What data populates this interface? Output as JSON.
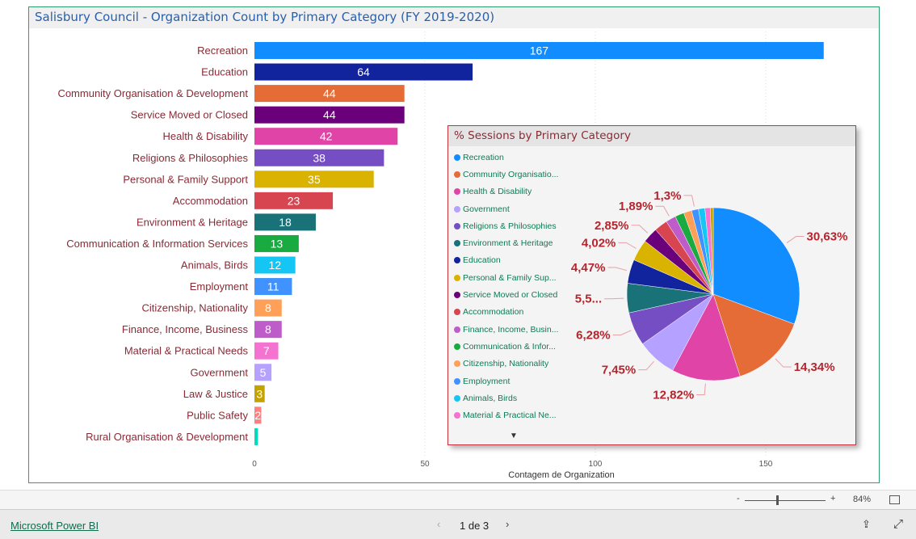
{
  "report_title": "Salisbury Council - Organization Count by Primary Category (FY 2019-2020)",
  "chart_data": [
    {
      "type": "bar",
      "orientation": "horizontal",
      "categories": [
        "Recreation",
        "Education",
        "Community Organisation & Development",
        "Service Moved or Closed",
        "Health & Disability",
        "Religions & Philosophies",
        "Personal & Family Support",
        "Accommodation",
        "Environment & Heritage",
        "Communication & Information Services",
        "Animals, Birds",
        "Employment",
        "Citizenship, Nationality",
        "Finance, Income, Business",
        "Material & Practical Needs",
        "Government",
        "Law & Justice",
        "Public Safety",
        "Rural Organisation & Development"
      ],
      "values": [
        167,
        64,
        44,
        44,
        42,
        38,
        35,
        23,
        18,
        13,
        12,
        11,
        8,
        8,
        7,
        5,
        3,
        2,
        1
      ],
      "data_labels": [
        "167",
        "64",
        "44",
        "44",
        "42",
        "38",
        "35",
        "23",
        "18",
        "13",
        "12",
        "11",
        "8",
        "8",
        "7",
        "5",
        "3",
        "2",
        ""
      ],
      "colors": [
        "#118DFF",
        "#12239E",
        "#E66C37",
        "#6B007B",
        "#E044A7",
        "#744EC2",
        "#D9B300",
        "#D64550",
        "#197278",
        "#1AAB40",
        "#15C6F4",
        "#4092FF",
        "#FFA058",
        "#BE5DC9",
        "#F472D0",
        "#B5A1FF",
        "#C4A200",
        "#FF8080",
        "#00DBBC"
      ],
      "xlabel": "Contagem de Organization",
      "xticks": [
        "0",
        "50",
        "100",
        "150"
      ],
      "xtick_values": [
        0,
        50,
        100,
        150
      ],
      "xlim": [
        0,
        180
      ],
      "grid": "vertical dotted"
    },
    {
      "type": "pie",
      "title": "% Sessions by Primary Category",
      "legend_position": "left",
      "categories": [
        "Recreation",
        "Community Organisatio...",
        "Health & Disability",
        "Government",
        "Religions & Philosophies",
        "Environment & Heritage",
        "Education",
        "Personal & Family Sup...",
        "Service Moved or Closed",
        "Accommodation",
        "Finance, Income, Busin...",
        "Communication & Infor...",
        "Citizenship, Nationality",
        "Employment",
        "Animals, Birds",
        "Material & Practical Ne..."
      ],
      "values": [
        30.63,
        14.34,
        12.82,
        7.45,
        6.28,
        5.5,
        4.47,
        4.02,
        2.85,
        2.5,
        1.89,
        1.7,
        1.5,
        1.3,
        1.2,
        1.0,
        0.55
      ],
      "colors": [
        "#118DFF",
        "#E66C37",
        "#E044A7",
        "#B5A1FF",
        "#744EC2",
        "#197278",
        "#12239E",
        "#D9B300",
        "#6B007B",
        "#D64550",
        "#BE5DC9",
        "#1AAB40",
        "#FFA058",
        "#4092FF",
        "#15C6F4",
        "#F472D0",
        "#C4A200"
      ],
      "data_labels": [
        {
          "text": "30,63%",
          "slice": 0
        },
        {
          "text": "14,34%",
          "slice": 1
        },
        {
          "text": "12,82%",
          "slice": 2
        },
        {
          "text": "7,45%",
          "slice": 3
        },
        {
          "text": "6,28%",
          "slice": 4
        },
        {
          "text": "5,5...",
          "slice": 5
        },
        {
          "text": "4,47%",
          "slice": 6
        },
        {
          "text": "4,02%",
          "slice": 7
        },
        {
          "text": "2,85%",
          "slice": 8
        },
        {
          "text": "1,89%",
          "slice": 10
        },
        {
          "text": "1,3%",
          "slice": 13
        }
      ]
    }
  ],
  "zoom": {
    "minus": "-",
    "plus": "+",
    "level": "84%"
  },
  "footer": {
    "brand": "Microsoft Power BI",
    "page": "1 de 3"
  }
}
